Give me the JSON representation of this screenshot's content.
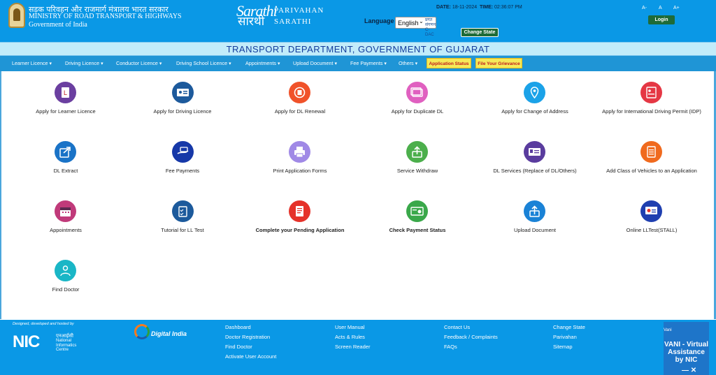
{
  "header": {
    "ministry_hindi": "सड़क परिवहन और राजमार्ग मंत्रालय भारत सरकार",
    "ministry_english": "MINISTRY OF ROAD TRANSPORT & HIGHWAYS",
    "government": "Government of India",
    "logo_sarathi": "Sarathi",
    "logo_sarathi_hindi": "सारथी",
    "logo_parivahan": "PARIVAHAN",
    "logo_sarathi_caps": "SARATHI",
    "date_label": "DATE:",
    "date_value": "18-11-2024",
    "time_label": "TIME:",
    "time_value": "02:36:07 PM",
    "language_label": "Language",
    "language_value": "English",
    "cdac_text": "प्रगत संगणन C-DAC",
    "change_state": "Change State",
    "font_small": "A-",
    "font_normal": "A",
    "font_large": "A+",
    "login": "Login"
  },
  "state_title": "TRANSPORT DEPARTMENT, GOVERNMENT OF GUJARAT",
  "nav": {
    "items": [
      {
        "label": "Learner Licence ▾"
      },
      {
        "label": "Driving Licence ▾"
      },
      {
        "label": "Conductor Licence ▾"
      },
      {
        "label": "Driving School Licence ▾"
      },
      {
        "label": "Appointments ▾"
      },
      {
        "label": "Upload Document ▾"
      },
      {
        "label": "Fee Payments ▾"
      },
      {
        "label": "Others ▾"
      }
    ],
    "application_status": "Application Status",
    "grievance": "File Your Grievance"
  },
  "tiles": [
    {
      "label": "Apply for Learner Licence",
      "icon": "learner-licence-icon",
      "color": "#6b3fa0",
      "bold": false
    },
    {
      "label": "Apply for Driving Licence",
      "icon": "driving-licence-card-icon",
      "color": "#1d5a9c",
      "bold": false
    },
    {
      "label": "Apply for DL Renewal",
      "icon": "dl-renewal-icon",
      "color": "#f0522a",
      "bold": false
    },
    {
      "label": "Apply for Duplicate DL",
      "icon": "duplicate-dl-icon",
      "color": "#e060c0",
      "bold": false
    },
    {
      "label": "Apply for Change of Address",
      "icon": "address-pin-icon",
      "color": "#1ba2e8",
      "bold": false
    },
    {
      "label": "Apply for International Driving Permit (IDP)",
      "icon": "international-permit-icon",
      "color": "#e53744",
      "bold": false
    },
    {
      "label": "DL Extract",
      "icon": "share-export-icon",
      "color": "#1a73c7",
      "bold": false
    },
    {
      "label": "Fee Payments",
      "icon": "payment-hand-icon",
      "color": "#1638a8",
      "bold": false
    },
    {
      "label": "Print Application Forms",
      "icon": "printer-icon",
      "color": "#a089e6",
      "bold": false
    },
    {
      "label": "Service Withdraw",
      "icon": "withdraw-upload-icon",
      "color": "#4caf4c",
      "bold": false
    },
    {
      "label": "DL Services (Replace of DL/Others)",
      "icon": "dl-services-card-icon",
      "color": "#5a3c9e",
      "bold": false
    },
    {
      "label": "Add Class of Vehicles to an Application",
      "icon": "vehicle-class-list-icon",
      "color": "#f06a1e",
      "bold": false
    },
    {
      "label": "Appointments",
      "icon": "calendar-icon",
      "color": "#c03a7a",
      "bold": false
    },
    {
      "label": "Tutorial for LL Test",
      "icon": "clipboard-checklist-icon",
      "color": "#1c5a9c",
      "bold": false
    },
    {
      "label": "Complete your Pending Application",
      "icon": "pending-form-icon",
      "color": "#e5322a",
      "bold": true
    },
    {
      "label": "Check Payment Status",
      "icon": "payment-status-icon",
      "color": "#3aa84a",
      "bold": true
    },
    {
      "label": "Upload Document",
      "icon": "upload-document-icon",
      "color": "#1a82d6",
      "bold": false
    },
    {
      "label": "Online LLTest(STALL)",
      "icon": "online-test-monitor-icon",
      "color": "#1f3fb0",
      "bold": false
    },
    {
      "label": "Find Doctor",
      "icon": "doctor-icon",
      "color": "#1ab6c6",
      "bold": false
    }
  ],
  "footer": {
    "designed_by": "Designed, developed and hosted by",
    "nic": "NIC",
    "nic_hindi": "एनआईसी",
    "nic_line1": "National",
    "nic_line2": "Informatics",
    "nic_line3": "Centre",
    "digital_india": "Digital India",
    "col1": [
      "Dashboard",
      "Doctor Registration",
      "Find Doctor",
      "Activate User Account"
    ],
    "col2": [
      "User Manual",
      "Acts & Rules",
      "Screen Reader"
    ],
    "col3": [
      "Contact Us",
      "Feedback / Complaints",
      "FAQs"
    ],
    "col4": [
      "Change State",
      "Parivahan",
      "Sitemap"
    ],
    "vani_img": "Vani",
    "vani_title": "VANI - Virtual Assistance by NIC",
    "vani_controls": "— ✕"
  }
}
